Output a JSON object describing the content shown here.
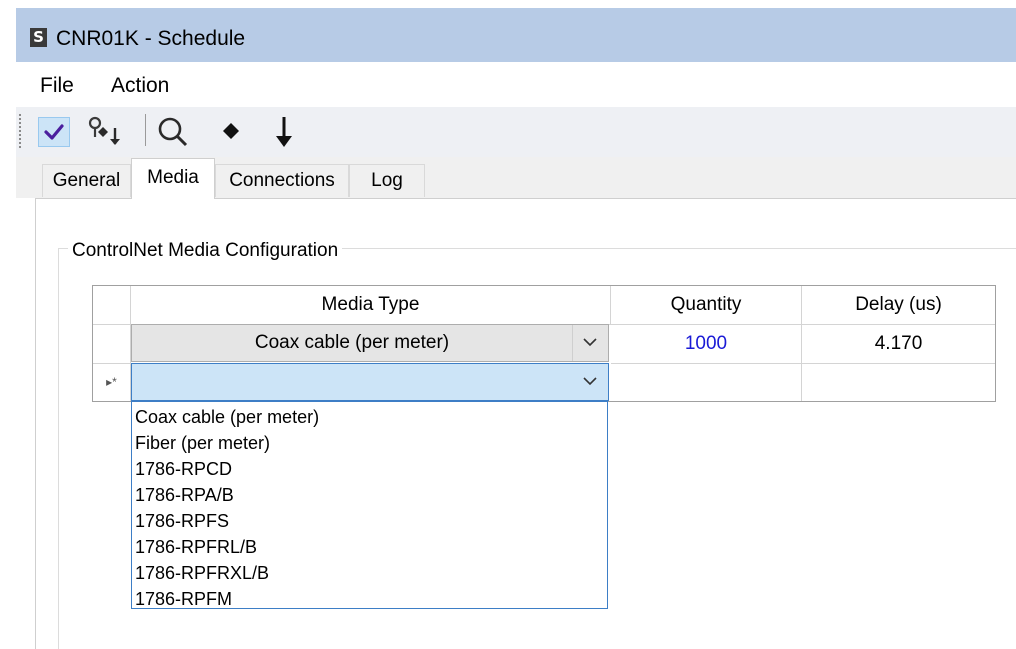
{
  "window": {
    "app_icon": "S",
    "title": "CNR01K - Schedule"
  },
  "menu": [
    "File",
    "Action"
  ],
  "toolbar": {
    "icons": [
      "checkmark-icon",
      "network-key-icon",
      "search-icon",
      "diamond-icon",
      "download-arrow-icon"
    ]
  },
  "tabs": [
    {
      "label": "General",
      "active": false
    },
    {
      "label": "Media",
      "active": true
    },
    {
      "label": "Connections",
      "active": false
    },
    {
      "label": "Log",
      "active": false
    }
  ],
  "group": {
    "title": "ControlNet Media Configuration"
  },
  "grid": {
    "columns": [
      "Media Type",
      "Quantity",
      "Delay (us)"
    ],
    "rows": [
      {
        "media_type": "Coax cable (per meter)",
        "quantity": "1000",
        "delay": "4.170"
      },
      {
        "media_type": "",
        "quantity": "",
        "delay": "",
        "new_row_marker": "▸*"
      }
    ]
  },
  "dropdown": {
    "options": [
      "Coax cable (per meter)",
      "Fiber (per meter)",
      "1786-RPCD",
      "1786-RPA/B",
      "1786-RPFS",
      "1786-RPFRL/B",
      "1786-RPFRXL/B",
      "1786-RPFM"
    ]
  },
  "colors": {
    "titlebar": "#b7cbe6",
    "quantity_text": "#1a1ad6",
    "selected_combo": "#cce4f7",
    "focus_border": "#3d7ec6"
  }
}
